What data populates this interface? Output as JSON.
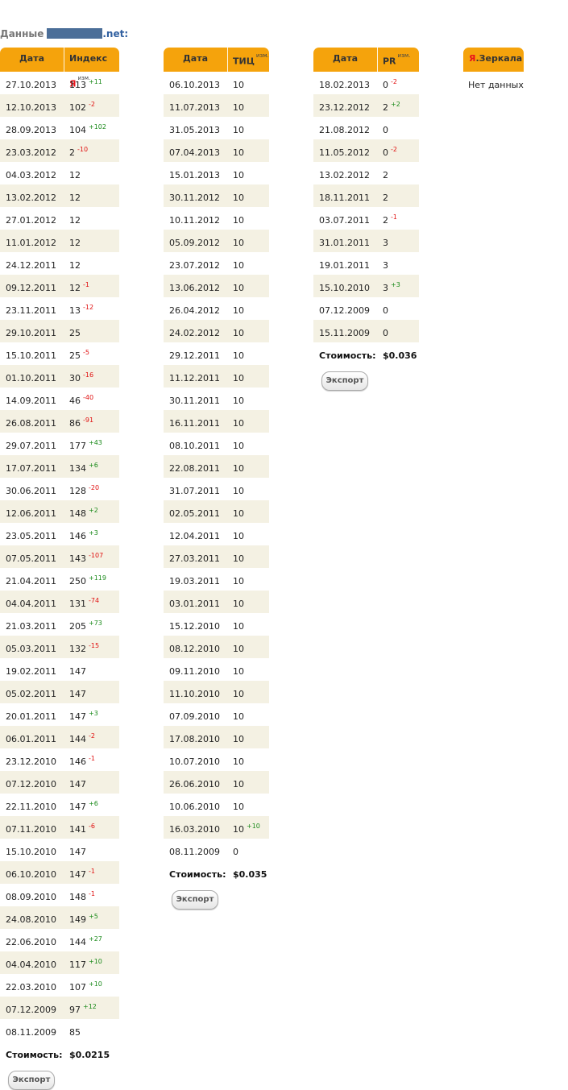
{
  "heading": {
    "label": "Данные",
    "tld": ".net",
    "colon": ":"
  },
  "yandex": {
    "col_date": "Дата",
    "col_value": "Индекс",
    "col_value_mark": "Я",
    "change_note": "изм.",
    "rows": [
      {
        "d": "27.10.2013",
        "v": "113",
        "c": "+11"
      },
      {
        "d": "12.10.2013",
        "v": "102",
        "c": "-2"
      },
      {
        "d": "28.09.2013",
        "v": "104",
        "c": "+102"
      },
      {
        "d": "23.03.2012",
        "v": "2",
        "c": "-10"
      },
      {
        "d": "04.03.2012",
        "v": "12",
        "c": ""
      },
      {
        "d": "13.02.2012",
        "v": "12",
        "c": ""
      },
      {
        "d": "27.01.2012",
        "v": "12",
        "c": ""
      },
      {
        "d": "11.01.2012",
        "v": "12",
        "c": ""
      },
      {
        "d": "24.12.2011",
        "v": "12",
        "c": ""
      },
      {
        "d": "09.12.2011",
        "v": "12",
        "c": "-1"
      },
      {
        "d": "23.11.2011",
        "v": "13",
        "c": "-12"
      },
      {
        "d": "29.10.2011",
        "v": "25",
        "c": ""
      },
      {
        "d": "15.10.2011",
        "v": "25",
        "c": "-5"
      },
      {
        "d": "01.10.2011",
        "v": "30",
        "c": "-16"
      },
      {
        "d": "14.09.2011",
        "v": "46",
        "c": "-40"
      },
      {
        "d": "26.08.2011",
        "v": "86",
        "c": "-91"
      },
      {
        "d": "29.07.2011",
        "v": "177",
        "c": "+43"
      },
      {
        "d": "17.07.2011",
        "v": "134",
        "c": "+6"
      },
      {
        "d": "30.06.2011",
        "v": "128",
        "c": "-20"
      },
      {
        "d": "12.06.2011",
        "v": "148",
        "c": "+2"
      },
      {
        "d": "23.05.2011",
        "v": "146",
        "c": "+3"
      },
      {
        "d": "07.05.2011",
        "v": "143",
        "c": "-107"
      },
      {
        "d": "21.04.2011",
        "v": "250",
        "c": "+119"
      },
      {
        "d": "04.04.2011",
        "v": "131",
        "c": "-74"
      },
      {
        "d": "21.03.2011",
        "v": "205",
        "c": "+73"
      },
      {
        "d": "05.03.2011",
        "v": "132",
        "c": "-15"
      },
      {
        "d": "19.02.2011",
        "v": "147",
        "c": ""
      },
      {
        "d": "05.02.2011",
        "v": "147",
        "c": ""
      },
      {
        "d": "20.01.2011",
        "v": "147",
        "c": "+3"
      },
      {
        "d": "06.01.2011",
        "v": "144",
        "c": "-2"
      },
      {
        "d": "23.12.2010",
        "v": "146",
        "c": "-1"
      },
      {
        "d": "07.12.2010",
        "v": "147",
        "c": ""
      },
      {
        "d": "22.11.2010",
        "v": "147",
        "c": "+6"
      },
      {
        "d": "07.11.2010",
        "v": "141",
        "c": "-6"
      },
      {
        "d": "15.10.2010",
        "v": "147",
        "c": ""
      },
      {
        "d": "06.10.2010",
        "v": "147",
        "c": "-1"
      },
      {
        "d": "08.09.2010",
        "v": "148",
        "c": "-1"
      },
      {
        "d": "24.08.2010",
        "v": "149",
        "c": "+5"
      },
      {
        "d": "22.06.2010",
        "v": "144",
        "c": "+27"
      },
      {
        "d": "04.04.2010",
        "v": "117",
        "c": "+10"
      },
      {
        "d": "22.03.2010",
        "v": "107",
        "c": "+10"
      },
      {
        "d": "07.12.2009",
        "v": "97",
        "c": "+12"
      },
      {
        "d": "08.11.2009",
        "v": "85",
        "c": ""
      }
    ],
    "cost_label": "Стоимость:",
    "cost_value": "$0.0215",
    "export_label": "Экспорт"
  },
  "tic": {
    "col_date": "Дата",
    "col_value": "ТИЦ",
    "change_note": "изм.",
    "rows": [
      {
        "d": "06.10.2013",
        "v": "10",
        "c": ""
      },
      {
        "d": "11.07.2013",
        "v": "10",
        "c": ""
      },
      {
        "d": "31.05.2013",
        "v": "10",
        "c": ""
      },
      {
        "d": "07.04.2013",
        "v": "10",
        "c": ""
      },
      {
        "d": "15.01.2013",
        "v": "10",
        "c": ""
      },
      {
        "d": "30.11.2012",
        "v": "10",
        "c": ""
      },
      {
        "d": "10.11.2012",
        "v": "10",
        "c": ""
      },
      {
        "d": "05.09.2012",
        "v": "10",
        "c": ""
      },
      {
        "d": "23.07.2012",
        "v": "10",
        "c": ""
      },
      {
        "d": "13.06.2012",
        "v": "10",
        "c": ""
      },
      {
        "d": "26.04.2012",
        "v": "10",
        "c": ""
      },
      {
        "d": "24.02.2012",
        "v": "10",
        "c": ""
      },
      {
        "d": "29.12.2011",
        "v": "10",
        "c": ""
      },
      {
        "d": "11.12.2011",
        "v": "10",
        "c": ""
      },
      {
        "d": "30.11.2011",
        "v": "10",
        "c": ""
      },
      {
        "d": "16.11.2011",
        "v": "10",
        "c": ""
      },
      {
        "d": "08.10.2011",
        "v": "10",
        "c": ""
      },
      {
        "d": "22.08.2011",
        "v": "10",
        "c": ""
      },
      {
        "d": "31.07.2011",
        "v": "10",
        "c": ""
      },
      {
        "d": "02.05.2011",
        "v": "10",
        "c": ""
      },
      {
        "d": "12.04.2011",
        "v": "10",
        "c": ""
      },
      {
        "d": "27.03.2011",
        "v": "10",
        "c": ""
      },
      {
        "d": "19.03.2011",
        "v": "10",
        "c": ""
      },
      {
        "d": "03.01.2011",
        "v": "10",
        "c": ""
      },
      {
        "d": "15.12.2010",
        "v": "10",
        "c": ""
      },
      {
        "d": "08.12.2010",
        "v": "10",
        "c": ""
      },
      {
        "d": "09.11.2010",
        "v": "10",
        "c": ""
      },
      {
        "d": "11.10.2010",
        "v": "10",
        "c": ""
      },
      {
        "d": "07.09.2010",
        "v": "10",
        "c": ""
      },
      {
        "d": "17.08.2010",
        "v": "10",
        "c": ""
      },
      {
        "d": "10.07.2010",
        "v": "10",
        "c": ""
      },
      {
        "d": "26.06.2010",
        "v": "10",
        "c": ""
      },
      {
        "d": "10.06.2010",
        "v": "10",
        "c": ""
      },
      {
        "d": "16.03.2010",
        "v": "10",
        "c": "+10"
      },
      {
        "d": "08.11.2009",
        "v": "0",
        "c": ""
      }
    ],
    "cost_label": "Стоимость:",
    "cost_value": "$0.035",
    "export_label": "Экспорт"
  },
  "pr": {
    "col_date": "Дата",
    "col_value": "PR",
    "change_note": "изм.",
    "rows": [
      {
        "d": "18.02.2013",
        "v": "0",
        "c": "-2"
      },
      {
        "d": "23.12.2012",
        "v": "2",
        "c": "+2"
      },
      {
        "d": "21.08.2012",
        "v": "0",
        "c": ""
      },
      {
        "d": "11.05.2012",
        "v": "0",
        "c": "-2"
      },
      {
        "d": "13.02.2012",
        "v": "2",
        "c": ""
      },
      {
        "d": "18.11.2011",
        "v": "2",
        "c": ""
      },
      {
        "d": "03.07.2011",
        "v": "2",
        "c": "-1"
      },
      {
        "d": "31.01.2011",
        "v": "3",
        "c": ""
      },
      {
        "d": "19.01.2011",
        "v": "3",
        "c": ""
      },
      {
        "d": "15.10.2010",
        "v": "3",
        "c": "+3"
      },
      {
        "d": "07.12.2009",
        "v": "0",
        "c": ""
      },
      {
        "d": "15.11.2009",
        "v": "0",
        "c": ""
      }
    ],
    "cost_label": "Стоимость:",
    "cost_value": "$0.036",
    "export_label": "Экспорт"
  },
  "mirrors": {
    "title_mark": "Я",
    "title": ".Зеркала",
    "empty_text": "Нет данных"
  },
  "colors": {
    "header": "#f5a30c",
    "alt_row": "#f4f1e3",
    "positive": "#1a8a1a",
    "negative": "#e01010"
  }
}
